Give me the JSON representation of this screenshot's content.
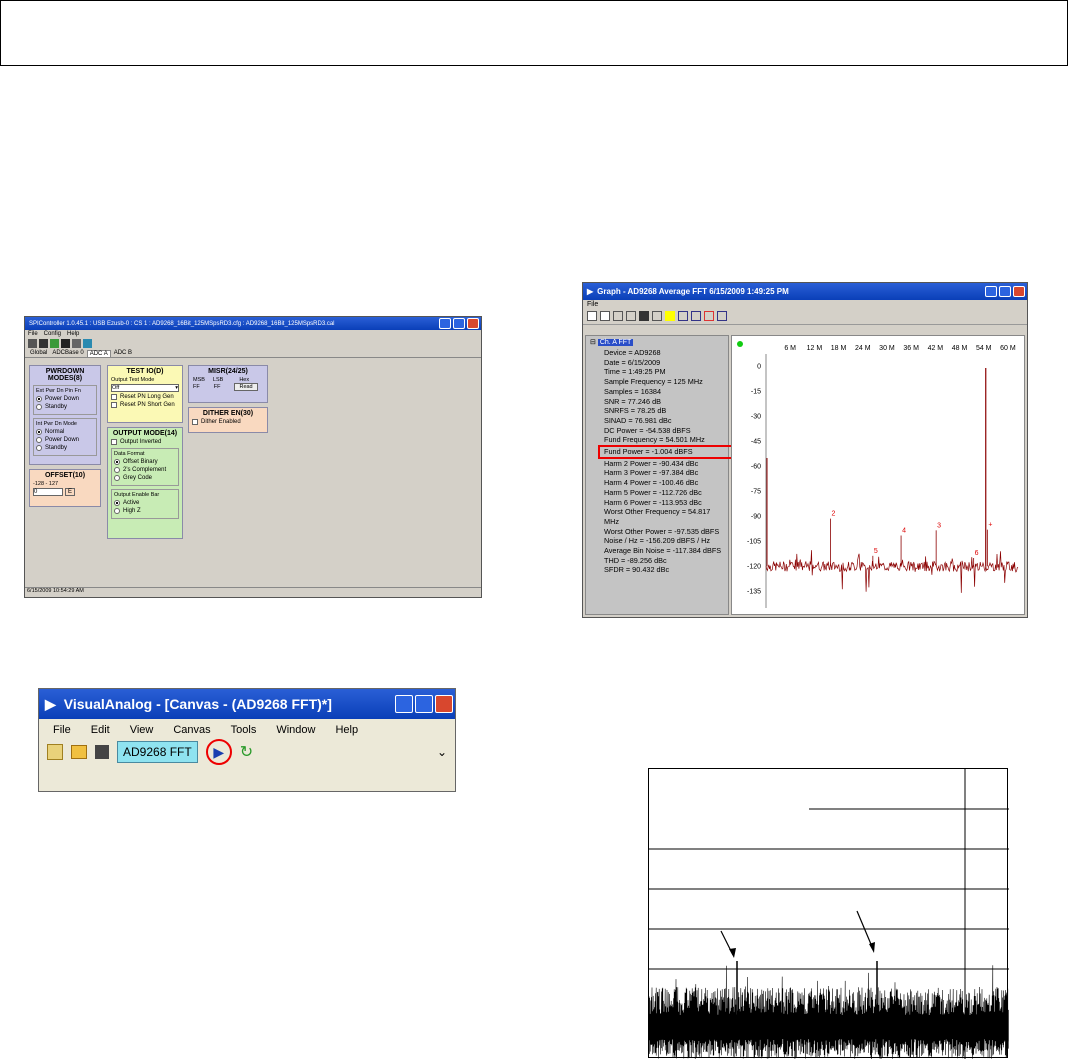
{
  "spi": {
    "title": "SPIController 1.0.45.1 : USB Ezusb-0 : CS 1 : AD9268_16Bit_125MSpsRD3.cfg : AD9268_16Bit_125MSpsRD3.cal",
    "menu": [
      "File",
      "Config",
      "Help"
    ],
    "tabs": [
      "Global",
      "ADCBase 0",
      "ADC A",
      "ADC B"
    ],
    "pwrdown": {
      "title": "PWRDOWN MODES(8)",
      "ext_label": "Ext Pwr Dn Pin Fn",
      "ext_opts": [
        "Power Down",
        "Standby"
      ],
      "int_label": "Int Pwr Dn Mode",
      "int_opts": [
        "Normal",
        "Power Down",
        "Standby"
      ]
    },
    "test": {
      "title": "TEST IO(D)",
      "mode_label": "Output Test Mode",
      "mode_value": "Off",
      "cb1": "Reset PN Long Gen",
      "cb2": "Reset PN Short Gen"
    },
    "misr": {
      "title": "MISR(24/25)",
      "msb": "MSB",
      "lsb": "LSB",
      "hex": "Hex",
      "ff1": "FF",
      "ff2": "FF",
      "read": "Read"
    },
    "dither": {
      "title": "DITHER EN(30)",
      "cb": "Dither Enabled"
    },
    "output": {
      "title": "OUTPUT MODE(14)",
      "inverted": "Output Inverted",
      "fmt_label": "Data Format",
      "fmt": [
        "Offset Binary",
        "2's Complement",
        "Grey Code"
      ],
      "en_label": "Output Enable Bar",
      "en": [
        "Active",
        "High Z"
      ]
    },
    "offset": {
      "title": "OFFSET(10)",
      "range": "-128 - 127",
      "value": "0",
      "btn": "E"
    },
    "status": "6/15/2009 10:54:29 AM"
  },
  "va": {
    "title": "VisualAnalog - [Canvas - (AD9268 FFT)*]",
    "menu": [
      "File",
      "Edit",
      "View",
      "Canvas",
      "Tools",
      "Window",
      "Help"
    ],
    "canvas_name": "AD9268 FFT"
  },
  "graph": {
    "title": "Graph - AD9268 Average FFT 6/15/2009 1:49:25 PM",
    "menu": "File",
    "tree": "Ch. A FFT",
    "stats": [
      "Device = AD9268",
      "Date = 6/15/2009",
      "Time = 1:49:25 PM",
      "Sample Frequency = 125 MHz",
      "Samples = 16384",
      "SNR = 77.246 dB",
      "SNRFS = 78.25 dB",
      "SINAD = 76.981 dBc",
      "DC Power = -54.538 dBFS",
      "Fund Frequency = 54.501 MHz",
      "Fund Power = -1.004 dBFS",
      "Harm 2 Power = -90.434 dBc",
      "Harm 3 Power = -97.384 dBc",
      "Harm 4 Power = -100.46 dBc",
      "Harm 5 Power = -112.726 dBc",
      "Harm 6 Power = -113.953 dBc",
      "Worst Other Frequency = 54.817 MHz",
      "Worst Other Power = -97.535 dBFS",
      "Noise / Hz = -156.209 dBFS / Hz",
      "Average Bin Noise = -117.384 dBFS",
      "THD = -89.256 dBc",
      "SFDR = 90.432 dBc"
    ],
    "xticks": [
      "6 M",
      "12 M",
      "18 M",
      "24 M",
      "30 M",
      "36 M",
      "42 M",
      "48 M",
      "54 M",
      "60 M"
    ],
    "yticks": [
      "0",
      "-15",
      "-30",
      "-45",
      "-60",
      "-75",
      "-90",
      "-105",
      "-120",
      "-135"
    ],
    "harm_labels": [
      "2",
      "5",
      "4",
      "3",
      "6",
      "+"
    ]
  },
  "chart_data": {
    "type": "line",
    "title": "AD9268 Average FFT",
    "xlabel": "",
    "ylabel": "",
    "x_ticks_MHz": [
      6,
      12,
      18,
      24,
      30,
      36,
      42,
      48,
      54,
      60
    ],
    "ylim": [
      -145,
      5
    ],
    "fundamental": {
      "freq_MHz": 54.501,
      "power_dBFS": -1.004
    },
    "harmonics": [
      {
        "label": "2",
        "dBFS": -91.4
      },
      {
        "label": "3",
        "dBFS": -98.4
      },
      {
        "label": "4",
        "dBFS": -101.5
      },
      {
        "label": "5",
        "dBFS": -113.7
      },
      {
        "label": "6",
        "dBFS": -115.0
      }
    ],
    "noise_floor_dBFS": -120
  },
  "colors": {
    "titlebar": "#0a3fb8",
    "highlight": "#e00000",
    "trace": "#8b0000"
  }
}
